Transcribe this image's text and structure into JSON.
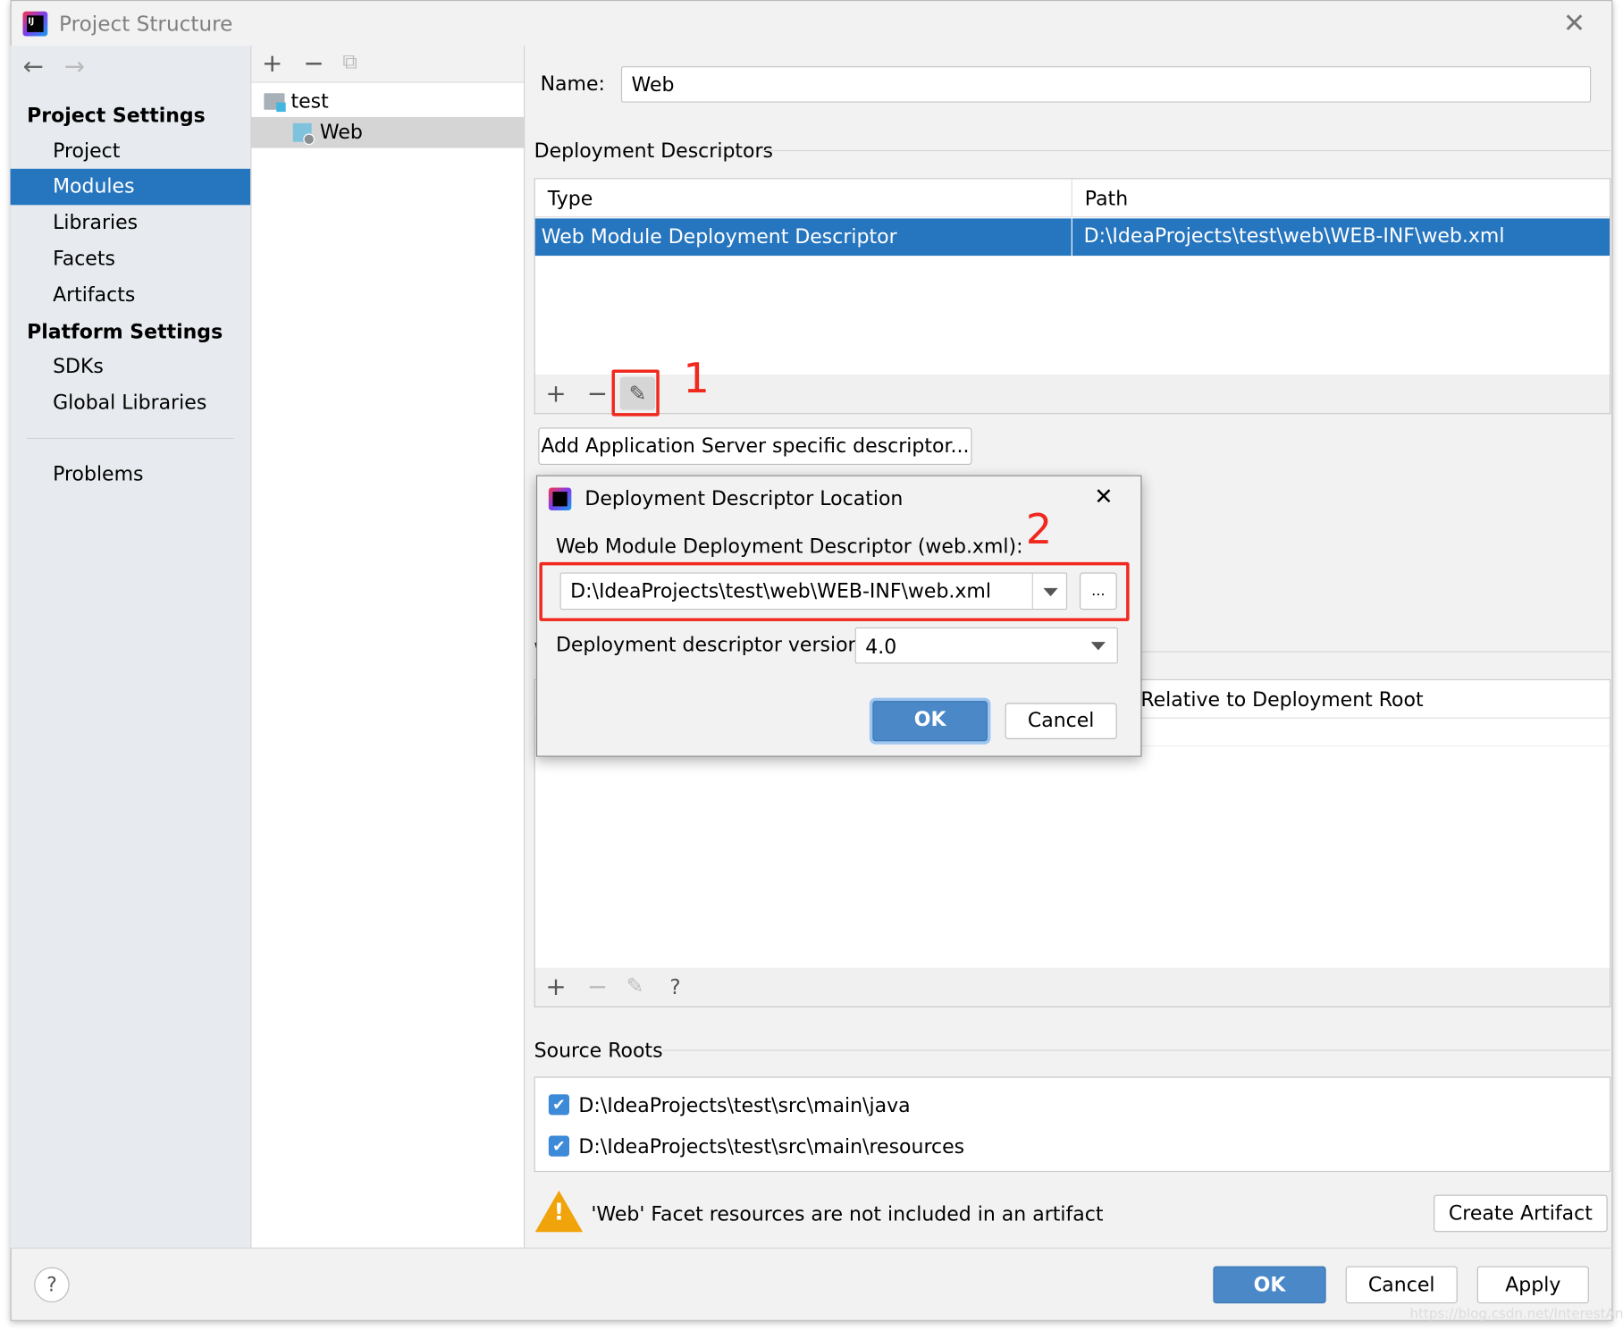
{
  "window": {
    "title": "Project Structure"
  },
  "sidebar": {
    "project_settings_header": "Project Settings",
    "items": [
      {
        "label": "Project"
      },
      {
        "label": "Modules",
        "selected": true
      },
      {
        "label": "Libraries"
      },
      {
        "label": "Facets"
      },
      {
        "label": "Artifacts"
      }
    ],
    "platform_settings_header": "Platform Settings",
    "platform_items": [
      {
        "label": "SDKs"
      },
      {
        "label": "Global Libraries"
      }
    ],
    "problems": "Problems"
  },
  "tree": {
    "items": [
      {
        "label": "test",
        "icon": "module-folder-icon"
      },
      {
        "label": "Web",
        "icon": "web-facet-icon",
        "selected": true
      }
    ]
  },
  "main": {
    "name_label": "Name:",
    "name_value": "Web",
    "deployment_descriptors": {
      "title": "Deployment Descriptors",
      "columns": [
        "Type",
        "Path"
      ],
      "rows": [
        {
          "type": "Web Module Deployment Descriptor",
          "path": "D:\\IdeaProjects\\test\\web\\WEB-INF\\web.xml",
          "selected": true
        }
      ],
      "annotation": "1"
    },
    "add_server_descriptor_button": "Add Application Server specific descriptor...",
    "web_resource_directories": {
      "title_visible": "W",
      "column_visible": "Relative to Deployment Root"
    },
    "source_roots": {
      "title": "Source Roots",
      "items": [
        {
          "path": "D:\\IdeaProjects\\test\\src\\main\\java",
          "checked": true
        },
        {
          "path": "D:\\IdeaProjects\\test\\src\\main\\resources",
          "checked": true
        }
      ]
    },
    "warning": "'Web' Facet resources are not included in an artifact",
    "create_artifact_button": "Create Artifact"
  },
  "footer": {
    "ok": "OK",
    "cancel": "Cancel",
    "apply": "Apply"
  },
  "dialog": {
    "title": "Deployment Descriptor Location",
    "descriptor_label": "Web Module Deployment Descriptor (web.xml):",
    "descriptor_value": "D:\\IdeaProjects\\test\\web\\WEB-INF\\web.xml",
    "browse_button": "...",
    "version_label": "Deployment descriptor version",
    "version_value": "4.0",
    "ok": "OK",
    "cancel": "Cancel",
    "annotation": "2"
  },
  "watermark": "https://blog.csdn.net/InterestAnd",
  "colors": {
    "selection": "#2675bf",
    "primary_button": "#4a88c7",
    "annotation": "#f0281e",
    "warning": "#f0a30a"
  }
}
